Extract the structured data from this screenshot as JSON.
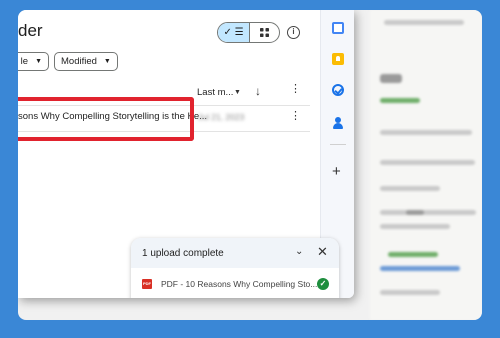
{
  "header": {
    "title_partial": "der",
    "view_toggle": {
      "list_check": "✓ ☰"
    }
  },
  "filters": {
    "type_label": "le",
    "modified_label": "Modified"
  },
  "columns": {
    "last_modified": "Last m..."
  },
  "file_row": {
    "name": "sons Why Compelling Storytelling is the Ke...",
    "date": "Jul 21, 2023"
  },
  "upload_panel": {
    "title": "1 upload complete",
    "file_label": "PDF - 10 Reasons Why Compelling Sto...",
    "file_icon_text": "PDF"
  },
  "colors": {
    "background": "#3a87d6",
    "highlight_border": "#e1232e",
    "toggle_active": "#c2e7ff",
    "success": "#1e8e3e"
  },
  "icons": {
    "view_list": "list-icon",
    "view_grid": "grid-icon",
    "info": "info-icon",
    "sort": "arrow-down-icon",
    "more": "more-vert-icon",
    "collapse": "chevron-down-icon",
    "close": "close-icon",
    "success": "check-circle-icon",
    "side": [
      "calendar-icon",
      "keep-icon",
      "tasks-icon",
      "contacts-icon",
      "add-icon"
    ]
  }
}
